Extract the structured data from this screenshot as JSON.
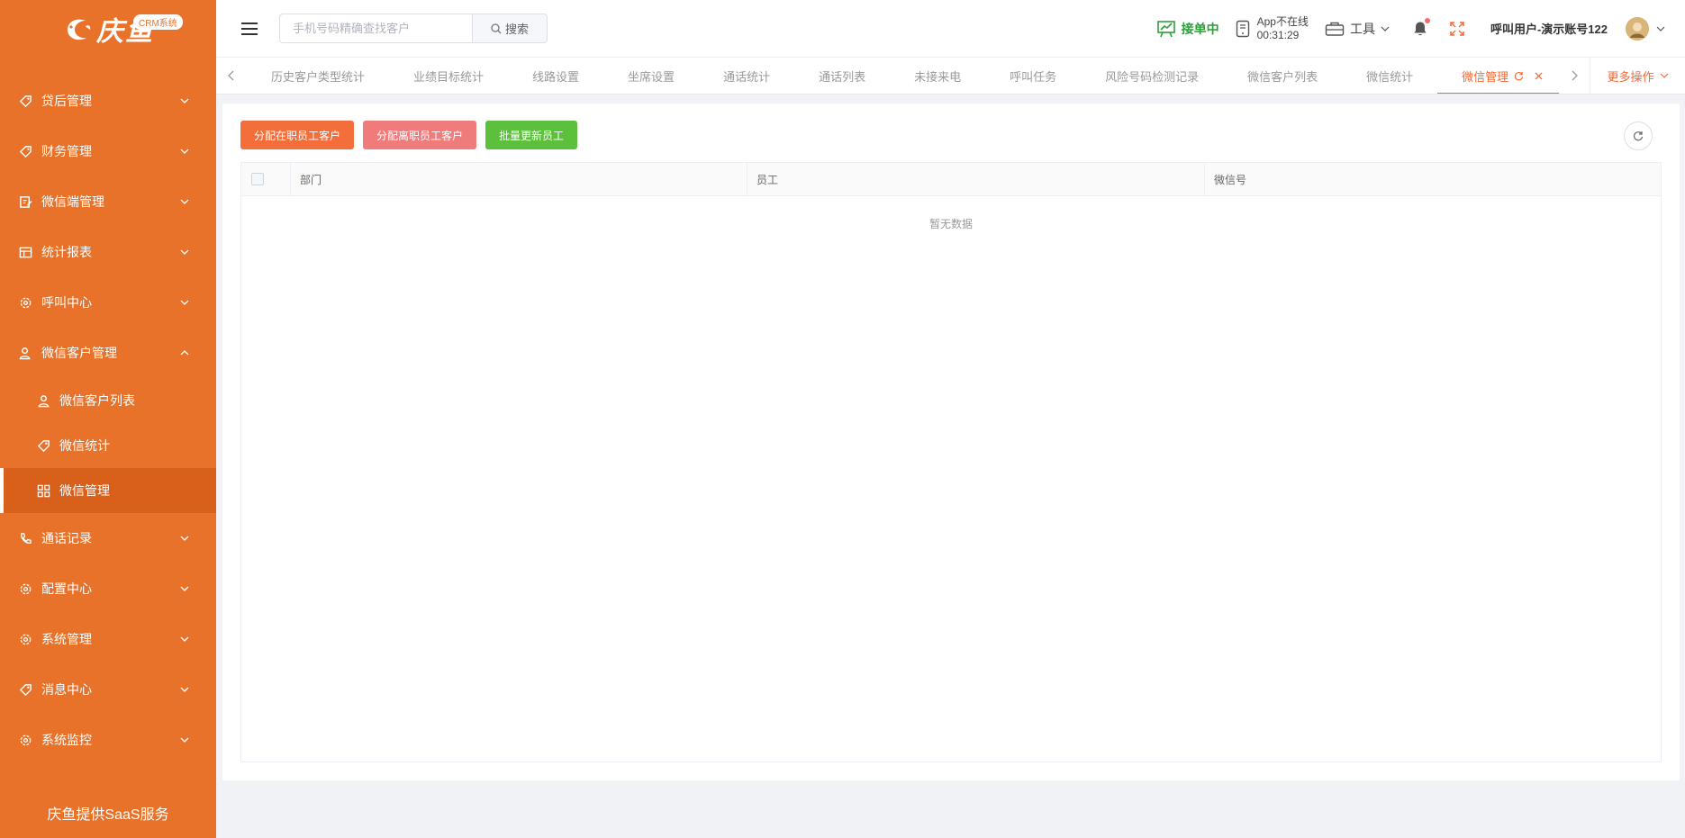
{
  "brand": {
    "name": "庆鱼",
    "badge": "CRM系统",
    "footer": "庆鱼提供SaaS服务"
  },
  "sidebar": {
    "items": [
      {
        "label": "贷后管理",
        "icon": "tag-icon",
        "expanded": false
      },
      {
        "label": "财务管理",
        "icon": "tag-icon",
        "expanded": false
      },
      {
        "label": "微信端管理",
        "icon": "edit-icon",
        "expanded": false
      },
      {
        "label": "统计报表",
        "icon": "table-icon",
        "expanded": false
      },
      {
        "label": "呼叫中心",
        "icon": "gear-icon",
        "expanded": false
      },
      {
        "label": "微信客户管理",
        "icon": "user-icon",
        "expanded": true
      },
      {
        "label": "通话记录",
        "icon": "phone-icon",
        "expanded": false
      },
      {
        "label": "配置中心",
        "icon": "gear-icon",
        "expanded": false
      },
      {
        "label": "系统管理",
        "icon": "gear-icon",
        "expanded": false
      },
      {
        "label": "消息中心",
        "icon": "tag-icon",
        "expanded": false
      },
      {
        "label": "系统监控",
        "icon": "gear-icon",
        "expanded": false
      }
    ],
    "sub_items": [
      {
        "label": "微信客户列表",
        "icon": "user-icon"
      },
      {
        "label": "微信统计",
        "icon": "tag-icon"
      },
      {
        "label": "微信管理",
        "icon": "grid-icon",
        "active": true
      }
    ]
  },
  "header": {
    "search_placeholder": "手机号码精确查找客户",
    "search_button": "搜索",
    "receiving": "接单中",
    "app_status": "App不在线",
    "app_time": "00:31:29",
    "tools": "工具",
    "user": "呼叫用户-演示账号122"
  },
  "tabs": {
    "items": [
      "历史客户类型统计",
      "业绩目标统计",
      "线路设置",
      "坐席设置",
      "通话统计",
      "通话列表",
      "未接来电",
      "呼叫任务",
      "风险号码检测记录",
      "微信客户列表",
      "微信统计",
      "微信管理"
    ],
    "active": "微信管理",
    "more": "更多操作"
  },
  "toolbar": {
    "assign_active": "分配在职员工客户",
    "assign_left": "分配离职员工客户",
    "bulk_update": "批量更新员工"
  },
  "table": {
    "columns": [
      "部门",
      "员工",
      "微信号"
    ],
    "empty_text": "暂无数据"
  },
  "colors": {
    "sidebar": "#e8722a",
    "accent": "#f26b3a",
    "green": "#2e9e3a"
  }
}
